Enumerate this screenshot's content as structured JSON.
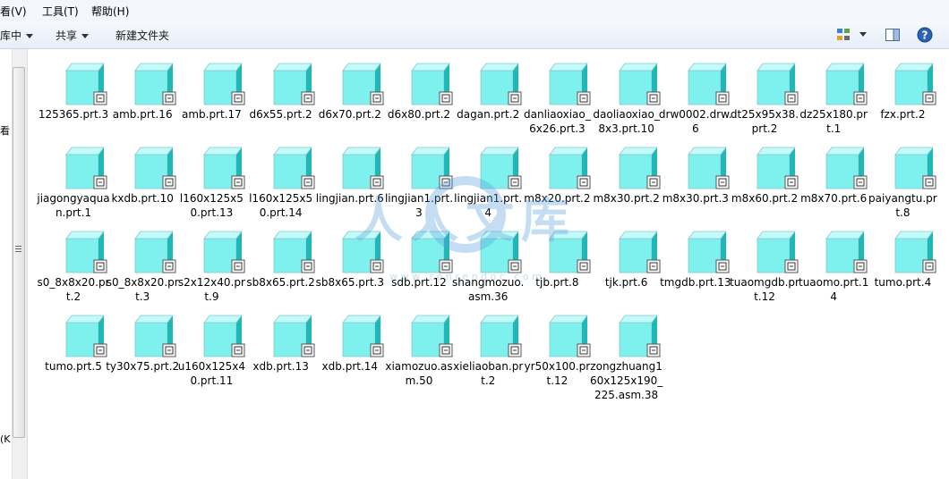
{
  "menubar": {
    "view": "看(V)",
    "tools": "工具(T)",
    "help": "帮助(H)"
  },
  "toolbar": {
    "include_in_library": "库中",
    "share": "共享",
    "new_folder": "新建文件夹"
  },
  "navpane": {
    "text1": "看",
    "text2": "(K"
  },
  "files": [
    "125365.prt.3",
    "amb.prt.16",
    "amb.prt.17",
    "d6x55.prt.2",
    "d6x70.prt.2",
    "d6x80.prt.2",
    "dagan.prt.2",
    "danliaoxiao_6x26.prt.3",
    "daoliaoxiao_8x3.prt.10",
    "drw0002.drw.6",
    "dt25x95x38.prt.2",
    "dz25x180.prt.1",
    "fzx.prt.2",
    "jiagongyaquan.prt.1",
    "kxdb.prt.10",
    "l160x125x50.prt.13",
    "l160x125x50.prt.14",
    "lingjian.prt.6",
    "lingjian1.prt.3",
    "lingjian1.prt.4",
    "m8x20.prt.2",
    "m8x30.prt.2",
    "m8x30.prt.3",
    "m8x60.prt.2",
    "m8x70.prt.6",
    "paiyangtu.prt.8",
    "s0_8x8x20.prt.2",
    "s0_8x8x20.prt.3",
    "s2x12x40.prt.9",
    "sb8x65.prt.2",
    "sb8x65.prt.3",
    "sdb.prt.12",
    "shangmozuo.asm.36",
    "tjb.prt.8",
    "tjk.prt.6",
    "tmgdb.prt.13",
    "tuaomgdb.prt.12",
    "tuaomo.prt.14",
    "tumo.prt.4",
    "tumo.prt.5",
    "ty30x75.prt.2",
    "u160x125x40.prt.11",
    "xdb.prt.13",
    "xdb.prt.14",
    "xiamozuo.asm.50",
    "xieliaoban.prt.2",
    "yr50x100.prt.12",
    "zongzhuang160x125x190_225.asm.38"
  ],
  "file_label_lines": [
    [
      ".prt",
      "125365.prt",
      ".3"
    ],
    null
  ],
  "watermark": {
    "chars": "人人文库",
    "url": "w w w . r e n r e n d o c . c o m"
  },
  "colors": {
    "icon_face": "#7ef0ee",
    "icon_side": "#20b7b7",
    "toolbar_bg": "#e6eef8"
  },
  "icons": [
    "views-icon",
    "preview-pane-icon",
    "help-icon",
    "creo-part-icon"
  ]
}
